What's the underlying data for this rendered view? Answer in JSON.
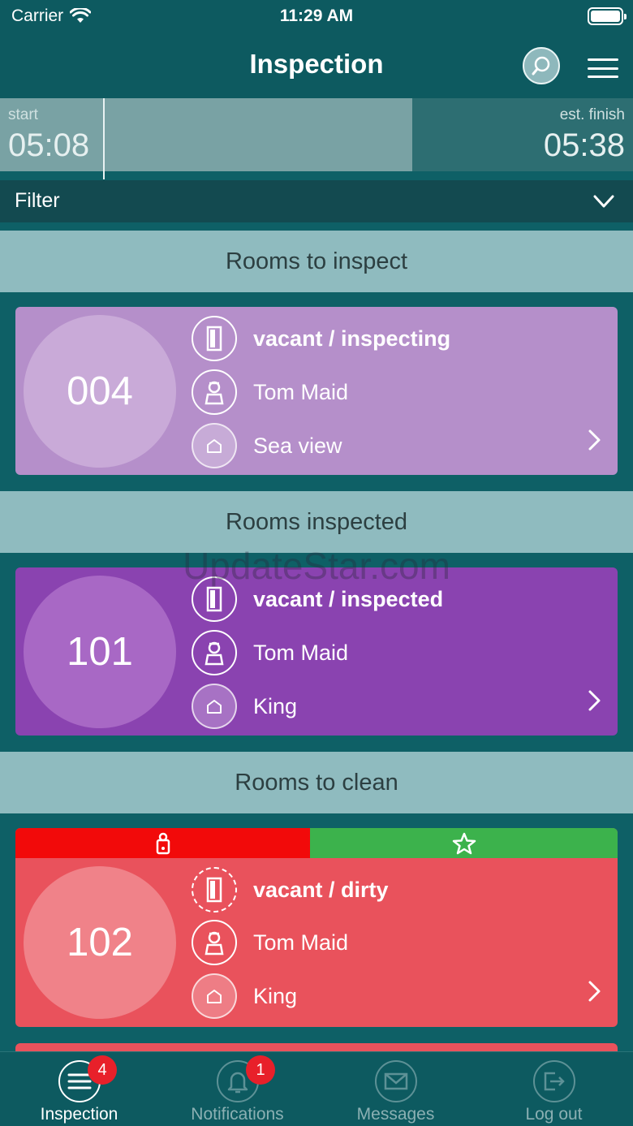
{
  "status_bar": {
    "carrier": "Carrier",
    "time": "11:29 AM"
  },
  "nav": {
    "title": "Inspection"
  },
  "timer": {
    "start_label": "start",
    "start_time": "05:08",
    "finish_label": "est. finish",
    "finish_time": "05:38"
  },
  "filter": {
    "label": "Filter"
  },
  "sections": [
    {
      "title": "Rooms to inspect"
    },
    {
      "title": "Rooms inspected"
    },
    {
      "title": "Rooms to clean"
    }
  ],
  "rooms": [
    {
      "number": "004",
      "status": "vacant / inspecting",
      "maid": "Tom Maid",
      "room_type": "Sea view",
      "color": "#b58fca"
    },
    {
      "number": "101",
      "status": "vacant / inspected",
      "maid": "Tom Maid",
      "room_type": "King",
      "color": "#8a43b0"
    },
    {
      "number": "102",
      "status": "vacant / dirty",
      "maid": "Tom Maid",
      "room_type": "King",
      "color": "#e9525c"
    }
  ],
  "banner_colors": {
    "dnd": "#f20a0a",
    "vip": "#3cb24c"
  },
  "watermark": "UpdateStar.com",
  "tabs": [
    {
      "label": "Inspection",
      "badge": "4"
    },
    {
      "label": "Notifications",
      "badge": "1"
    },
    {
      "label": "Messages"
    },
    {
      "label": "Log out"
    }
  ]
}
